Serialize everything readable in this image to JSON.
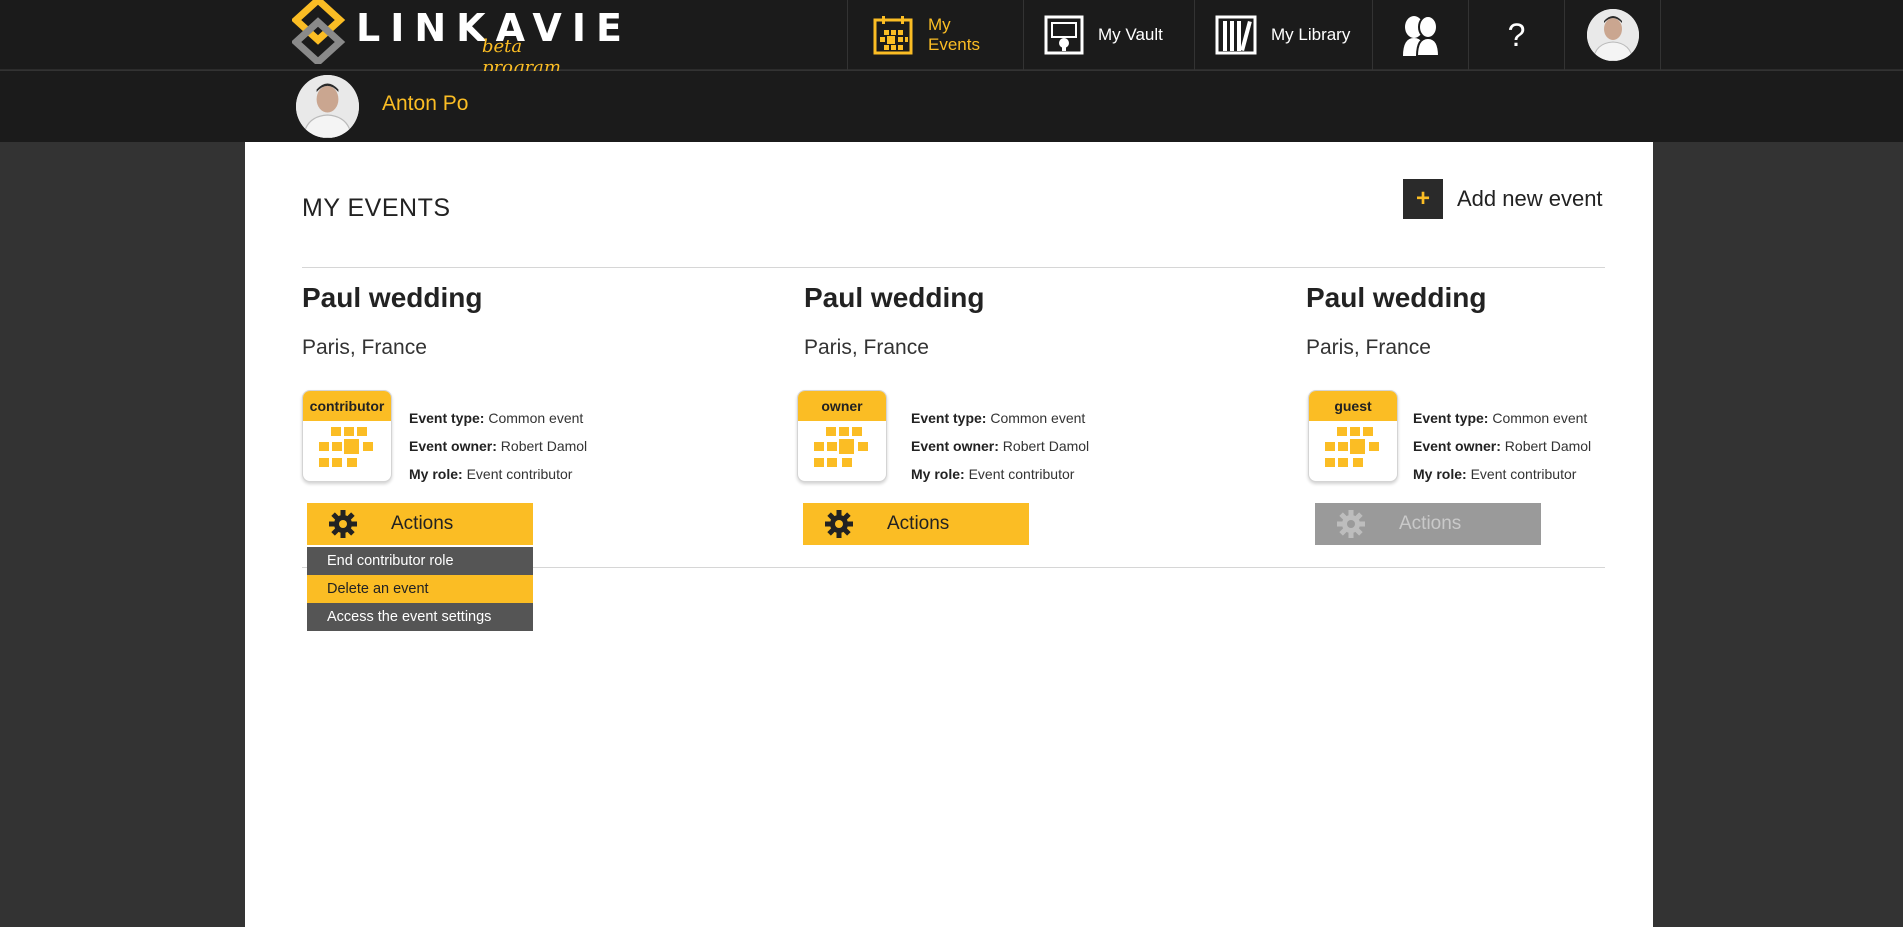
{
  "brand": {
    "name": "LINKAVIE",
    "tagline": "beta program",
    "accent": "#fbbd24"
  },
  "nav": {
    "items": [
      {
        "label": "My Events",
        "icon": "calendar-icon",
        "active": true
      },
      {
        "label": "My Vault",
        "icon": "vault-icon"
      },
      {
        "label": "My Library",
        "icon": "library-icon"
      },
      {
        "label": "",
        "icon": "contacts-icon"
      },
      {
        "label": "?",
        "icon": "help-icon"
      },
      {
        "label": "",
        "icon": "avatar-icon"
      }
    ]
  },
  "user": {
    "name": "Anton Po"
  },
  "page": {
    "title": "MY EVENTS",
    "add_label": "Add new event",
    "add_symbol": "+"
  },
  "labels": {
    "event_type": "Event type:",
    "event_owner": "Event owner:",
    "my_role": "My role:"
  },
  "events": [
    {
      "title": "Paul wedding",
      "location": "Paris, France",
      "badge": "contributor",
      "event_type": "Common event",
      "event_owner": "Robert Damol",
      "my_role": "Event contributor",
      "actions_label": "Actions",
      "actions_enabled": true
    },
    {
      "title": "Paul wedding",
      "location": "Paris, France",
      "badge": "owner",
      "event_type": "Common event",
      "event_owner": "Robert Damol",
      "my_role": "Event contributor",
      "actions_label": "Actions",
      "actions_enabled": true
    },
    {
      "title": "Paul wedding",
      "location": "Paris, France",
      "badge": "guest",
      "event_type": "Common event",
      "event_owner": "Robert Damol",
      "my_role": "Event contributor",
      "actions_label": "Actions",
      "actions_enabled": false
    }
  ],
  "dropdown": {
    "items": [
      {
        "label": "End contributor role"
      },
      {
        "label": "Delete an event",
        "highlighted": true
      },
      {
        "label": "Access the event settings"
      }
    ]
  },
  "colors": {
    "topbar": "#1b1b1b",
    "page_bg": "#333333",
    "disabled": "#9a9a9a",
    "dropdown": "#555555"
  }
}
